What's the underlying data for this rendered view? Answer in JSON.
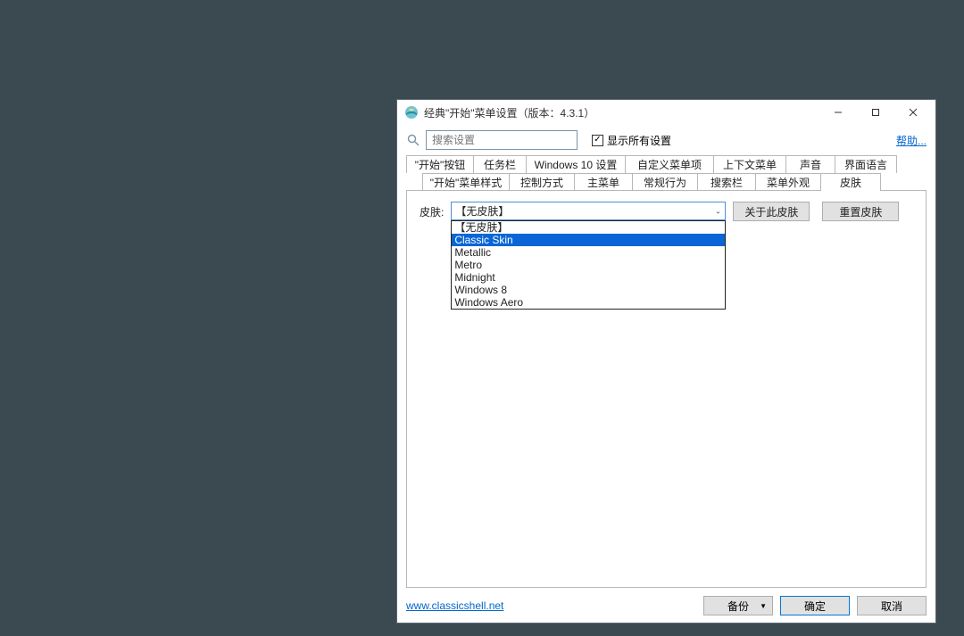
{
  "window": {
    "title": "经典\"开始\"菜单设置（版本：4.3.1）"
  },
  "toolbar": {
    "search_placeholder": "搜索设置",
    "show_all_label": "显示所有设置",
    "help_label": "帮助..."
  },
  "tabs": {
    "row1": [
      "\"开始\"按钮",
      "任务栏",
      "Windows 10 设置",
      "自定义菜单项",
      "上下文菜单",
      "声音",
      "界面语言"
    ],
    "row2": [
      "\"开始\"菜单样式",
      "控制方式",
      "主菜单",
      "常规行为",
      "搜索栏",
      "菜单外观",
      "皮肤"
    ]
  },
  "panel": {
    "skin_label": "皮肤:",
    "combo_value": "【无皮肤】",
    "about_label": "关于此皮肤",
    "reset_label": "重置皮肤",
    "options": [
      "【无皮肤】",
      "Classic Skin",
      "Metallic",
      "Metro",
      "Midnight",
      "Windows 8",
      "Windows Aero"
    ],
    "selected_index": 1
  },
  "footer": {
    "url": "www.classicshell.net",
    "backup_label": "备份",
    "ok_label": "确定",
    "cancel_label": "取消"
  }
}
